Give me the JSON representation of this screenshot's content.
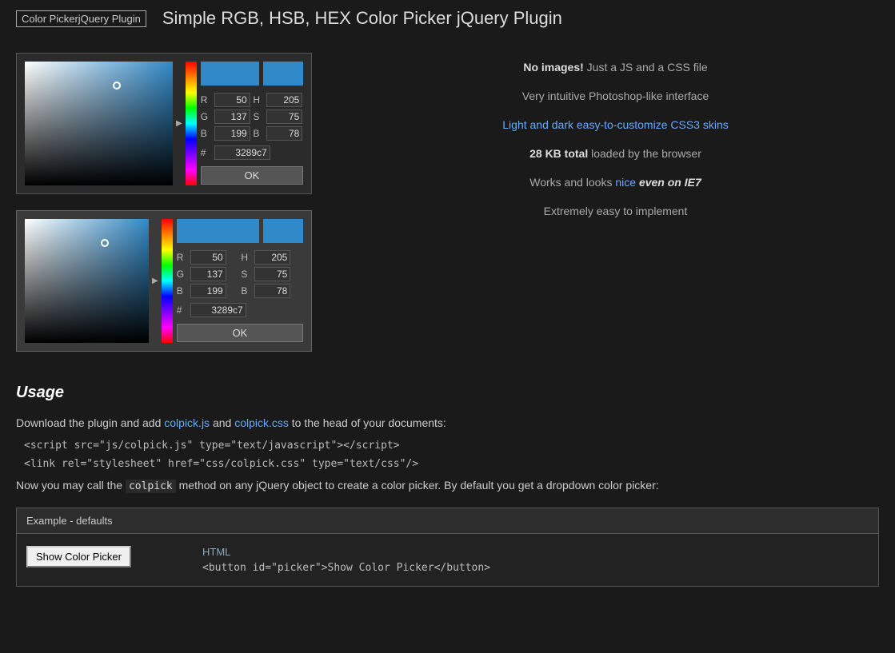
{
  "header": {
    "logo_text": "Color PickerjQuery Plugin",
    "title": "Simple RGB, HSB, HEX Color Picker jQuery Plugin"
  },
  "picker1": {
    "r": "50",
    "g": "137",
    "b": "199",
    "h": "205",
    "s": "75",
    "b_hsb": "78",
    "hex": "3289c7"
  },
  "picker2": {
    "r": "50",
    "g": "137",
    "b": "199",
    "h": "205",
    "s": "75",
    "b_hsb": "78",
    "hex": "3289c7"
  },
  "features": [
    {
      "id": "no-images",
      "bold": "No images!",
      "rest": " Just a JS and a CSS file"
    },
    {
      "id": "intuitive",
      "text": "Very intuitive Photoshop-like interface"
    },
    {
      "id": "skins",
      "text": "Light and dark easy-to-customize CSS3 skins"
    },
    {
      "id": "size",
      "bold": "28 KB total",
      "rest": " loaded by the browser"
    },
    {
      "id": "ie7",
      "pre": "Works and looks ",
      "accent": "nice",
      "italic": "even on IE7"
    },
    {
      "id": "easy",
      "text": "Extremely easy to implement"
    }
  ],
  "usage": {
    "heading": "Usage",
    "intro_text": "Download the plugin and add ",
    "file1": "colpick.js",
    "and_text": " and ",
    "file2": "colpick.css",
    "rest_text": " to the head of your documents:",
    "code1": "<script src=\"js/colpick.js\" type=\"text/javascript\"></script>",
    "code2": "<link rel=\"stylesheet\" href=\"css/colpick.css\" type=\"text/css\"/>",
    "call_text1": "Now you may call the ",
    "call_code": "colpick",
    "call_text2": " method on any jQuery object to create a color picker. By default you get a dropdown color picker:"
  },
  "example": {
    "header": "Example - defaults",
    "button_label": "Show Color Picker",
    "html_label": "HTML",
    "html_code": "<button id=\"picker\">Show Color Picker</button>"
  },
  "ok_label": "OK"
}
